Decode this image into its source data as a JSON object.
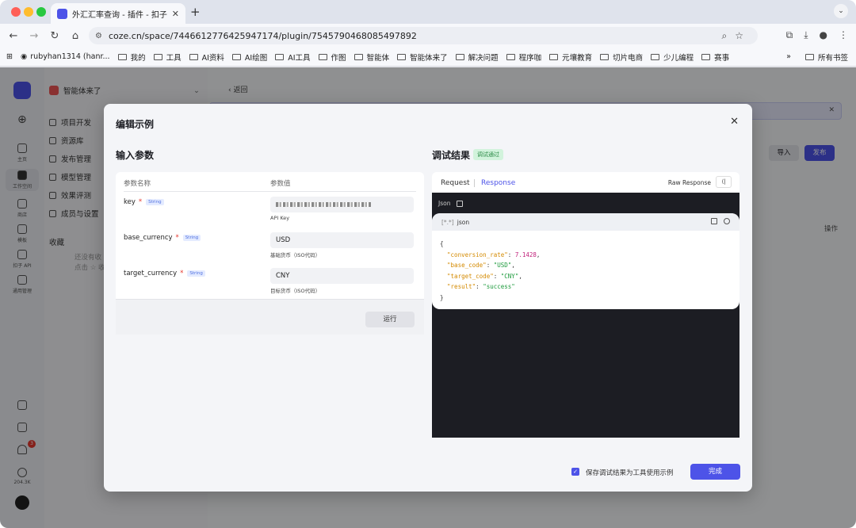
{
  "browser": {
    "tab_title": "外汇汇率查询 - 插件 - 扣子",
    "url": "coze.cn/space/7446612776425947174/plugin/7545790468085497892",
    "bookmarks": [
      "rubyhan1314 (hanr...",
      "我的",
      "工具",
      "AI资料",
      "AI绘图",
      "AI工具",
      "作图",
      "智能体",
      "智能体来了",
      "解决问题",
      "程序咖",
      "元壤教育",
      "切片电商",
      "少儿编程",
      "赛事"
    ],
    "bookmarks_more": "»",
    "all_bookmarks": "所有书签"
  },
  "rail": {
    "items": [
      "主页",
      "工作空间",
      "商店",
      "模板",
      "扣子 API",
      "通用管理"
    ],
    "follower_count": "204.3K",
    "notification_count": "3"
  },
  "sidebar": {
    "workspace": "智能体来了",
    "items": [
      "项目开发",
      "资源库",
      "发布管理",
      "模型管理",
      "效果评测",
      "成员与设置"
    ],
    "favorites_title": "收藏",
    "favorites_hint_1": "还没有收",
    "favorites_hint_2": "点击 ☆ 收"
  },
  "main": {
    "back": "返回",
    "import_label": "导入",
    "publish_label": "发布",
    "ops_header": "操作"
  },
  "modal": {
    "title": "编辑示例",
    "input_section": "输入参数",
    "result_section": "调试结果",
    "result_badge": "调试通过",
    "col_name": "参数名称",
    "col_value": "参数值",
    "params": [
      {
        "name": "key",
        "type": "String",
        "value": "",
        "desc": "API Key"
      },
      {
        "name": "base_currency",
        "type": "String",
        "value": "USD",
        "desc": "基础货币（ISO代码）"
      },
      {
        "name": "target_currency",
        "type": "String",
        "value": "CNY",
        "desc": "目标货币（ISO代码）"
      }
    ],
    "run_label": "运行",
    "tab_request": "Request",
    "tab_response": "Response",
    "raw_response": "Raw Response",
    "format_label": "Json",
    "code_label": "json",
    "code_tag": "[*.*]",
    "json_result": {
      "conversion_rate": "7.1428",
      "base_code": "\"USD\"",
      "target_code": "\"CNY\"",
      "result": "\"success\""
    },
    "save_checkbox_label": "保存调试结果为工具使用示例",
    "save_checked": true,
    "done_label": "完成"
  },
  "colors": {
    "accent": "#4d53e8",
    "success_badge_bg": "#d2f3dc"
  }
}
